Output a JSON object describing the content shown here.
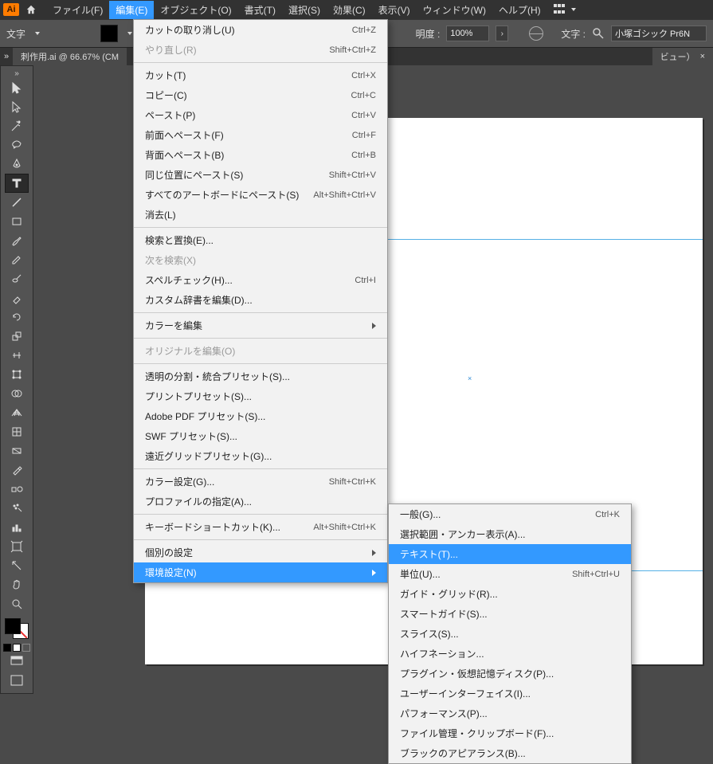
{
  "menubar": {
    "logo_text": "Ai",
    "items": [
      "ファイル(F)",
      "編集(E)",
      "オブジェクト(O)",
      "書式(T)",
      "選択(S)",
      "効果(C)",
      "表示(V)",
      "ウィンドウ(W)",
      "ヘルプ(H)"
    ],
    "active_index": 1
  },
  "controlbar": {
    "char_label": "文字",
    "opacity_label": "明度 :",
    "opacity_value": "100%",
    "font_label": "文字 :",
    "font_value": "小塚ゴシック Pr6N"
  },
  "tabs": {
    "document_tab": "刺作用.ai @ 66.67% (CM",
    "doc_tab_short": "ビュー）",
    "close_x": "×"
  },
  "tools": [
    "selection-tool",
    "direct-selection-tool",
    "magic-wand-tool",
    "lasso-tool",
    "pen-tool",
    "type-tool",
    "line-tool",
    "rectangle-tool",
    "paintbrush-tool",
    "pencil-tool",
    "blob-brush-tool",
    "eraser-tool",
    "rotate-tool",
    "scale-tool",
    "width-tool",
    "free-transform-tool",
    "shape-builder-tool",
    "perspective-grid-tool",
    "mesh-tool",
    "gradient-tool",
    "eyedropper-tool",
    "blend-tool",
    "symbol-sprayer-tool",
    "column-graph-tool",
    "artboard-tool",
    "slice-tool",
    "hand-tool",
    "zoom-tool"
  ],
  "tool_selected_index": 5,
  "edit_menu": {
    "groups": [
      [
        {
          "label": "カットの取り消し(U)",
          "shortcut": "Ctrl+Z"
        },
        {
          "label": "やり直し(R)",
          "shortcut": "Shift+Ctrl+Z",
          "disabled": true
        }
      ],
      [
        {
          "label": "カット(T)",
          "shortcut": "Ctrl+X"
        },
        {
          "label": "コピー(C)",
          "shortcut": "Ctrl+C"
        },
        {
          "label": "ペースト(P)",
          "shortcut": "Ctrl+V"
        },
        {
          "label": "前面へペースト(F)",
          "shortcut": "Ctrl+F"
        },
        {
          "label": "背面へペースト(B)",
          "shortcut": "Ctrl+B"
        },
        {
          "label": "同じ位置にペースト(S)",
          "shortcut": "Shift+Ctrl+V"
        },
        {
          "label": "すべてのアートボードにペースト(S)",
          "shortcut": "Alt+Shift+Ctrl+V"
        },
        {
          "label": "消去(L)",
          "shortcut": ""
        }
      ],
      [
        {
          "label": "検索と置換(E)...",
          "shortcut": ""
        },
        {
          "label": "次を検索(X)",
          "shortcut": "",
          "disabled": true
        },
        {
          "label": "スペルチェック(H)...",
          "shortcut": "Ctrl+I"
        },
        {
          "label": "カスタム辞書を編集(D)...",
          "shortcut": ""
        }
      ],
      [
        {
          "label": "カラーを編集",
          "shortcut": "",
          "submenu": true
        }
      ],
      [
        {
          "label": "オリジナルを編集(O)",
          "shortcut": "",
          "disabled": true
        }
      ],
      [
        {
          "label": "透明の分割・統合プリセット(S)...",
          "shortcut": ""
        },
        {
          "label": "プリントプリセット(S)...",
          "shortcut": ""
        },
        {
          "label": "Adobe PDF プリセット(S)...",
          "shortcut": ""
        },
        {
          "label": "SWF プリセット(S)...",
          "shortcut": ""
        },
        {
          "label": "遠近グリッドプリセット(G)...",
          "shortcut": ""
        }
      ],
      [
        {
          "label": "カラー設定(G)...",
          "shortcut": "Shift+Ctrl+K"
        },
        {
          "label": "プロファイルの指定(A)...",
          "shortcut": ""
        }
      ],
      [
        {
          "label": "キーボードショートカット(K)...",
          "shortcut": "Alt+Shift+Ctrl+K"
        }
      ],
      [
        {
          "label": "個別の設定",
          "shortcut": "",
          "submenu": true
        },
        {
          "label": "環境設定(N)",
          "shortcut": "",
          "submenu": true,
          "selected": true
        }
      ]
    ]
  },
  "prefs_submenu": {
    "groups": [
      [
        {
          "label": "一般(G)...",
          "shortcut": "Ctrl+K"
        },
        {
          "label": "選択範囲・アンカー表示(A)...",
          "shortcut": ""
        },
        {
          "label": "テキスト(T)...",
          "shortcut": "",
          "selected": true
        },
        {
          "label": "単位(U)...",
          "shortcut": "Shift+Ctrl+U"
        },
        {
          "label": "ガイド・グリッド(R)...",
          "shortcut": ""
        },
        {
          "label": "スマートガイド(S)...",
          "shortcut": ""
        },
        {
          "label": "スライス(S)...",
          "shortcut": ""
        },
        {
          "label": "ハイフネーション...",
          "shortcut": ""
        },
        {
          "label": "プラグイン・仮想記憶ディスク(P)...",
          "shortcut": ""
        },
        {
          "label": "ユーザーインターフェイス(I)...",
          "shortcut": ""
        },
        {
          "label": "パフォーマンス(P)...",
          "shortcut": ""
        },
        {
          "label": "ファイル管理・クリップボード(F)...",
          "shortcut": ""
        },
        {
          "label": "ブラックのアピアランス(B)...",
          "shortcut": ""
        }
      ]
    ]
  }
}
